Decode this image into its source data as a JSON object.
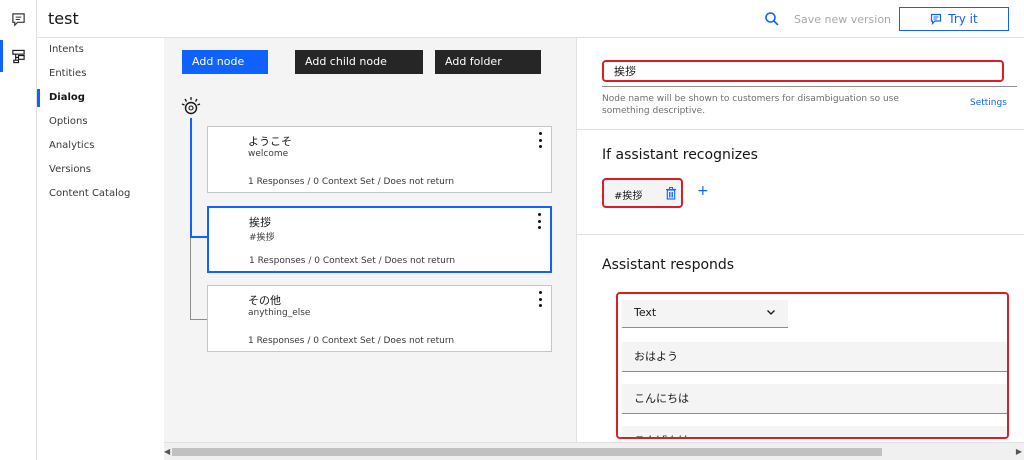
{
  "app": {
    "title": "test"
  },
  "header": {
    "save_version": "Save new version",
    "try_it": "Try it"
  },
  "nav": {
    "items": [
      "Intents",
      "Entities",
      "Dialog",
      "Options",
      "Analytics",
      "Versions",
      "Content Catalog"
    ],
    "active": "Dialog"
  },
  "toolbar": {
    "add_node": "Add node",
    "add_child_node": "Add child node",
    "add_folder": "Add folder"
  },
  "nodes": [
    {
      "title": "ようこそ",
      "condition": "welcome",
      "meta": "1 Responses / 0 Context Set / Does not return"
    },
    {
      "title": "挨拶",
      "condition": "#挨拶",
      "meta": "1 Responses / 0 Context Set / Does not return"
    },
    {
      "title": "その他",
      "condition": "anything_else",
      "meta": "1 Responses / 0 Context Set / Does not return"
    }
  ],
  "panel": {
    "node_name": "挨拶",
    "hint": "Node name will be shown to customers for disambiguation so use something descriptive.",
    "settings": "Settings",
    "recognizes_title": "If assistant recognizes",
    "condition": "#挨拶",
    "add_symbol": "+",
    "responds_title": "Assistant responds",
    "response_type": "Text",
    "responses": [
      "おはよう",
      "こんにちは",
      "こんばんは"
    ]
  },
  "colors": {
    "accent": "#0f62fe",
    "highlight": "#da1e28",
    "dark_button": "#262626"
  }
}
